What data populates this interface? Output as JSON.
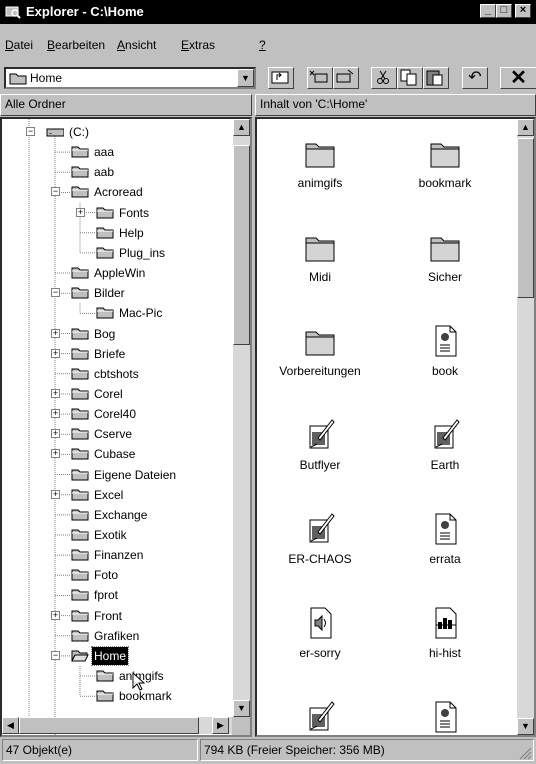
{
  "window": {
    "title": "Explorer - C:\\Home",
    "buttons": {
      "minimize": "_",
      "maximize": "□",
      "close": "×"
    }
  },
  "menu": [
    {
      "label": "Datei",
      "key": "D"
    },
    {
      "label": "Bearbeiten",
      "key": "B"
    },
    {
      "label": "Ansicht",
      "key": "A"
    },
    {
      "label": "Extras",
      "key": "E"
    },
    {
      "label": "?",
      "key": "?"
    }
  ],
  "address": {
    "value": "Home"
  },
  "toolbar": {
    "undo": "↶",
    "delete": "✕"
  },
  "left_header": "Alle Ordner",
  "right_header": "Inhalt von 'C:\\Home'",
  "tree": [
    {
      "label": "(C:)",
      "expander": "-",
      "kind": "drive"
    },
    {
      "label": "aaa",
      "expander": ""
    },
    {
      "label": "aab",
      "expander": ""
    },
    {
      "label": "Acroread",
      "expander": "-"
    },
    {
      "label": "Fonts",
      "expander": "+"
    },
    {
      "label": "Help",
      "expander": ""
    },
    {
      "label": "Plug_ins",
      "expander": ""
    },
    {
      "label": "AppleWin",
      "expander": ""
    },
    {
      "label": "Bilder",
      "expander": "-"
    },
    {
      "label": "Mac-Pic",
      "expander": ""
    },
    {
      "label": "Bog",
      "expander": "+"
    },
    {
      "label": "Briefe",
      "expander": "+"
    },
    {
      "label": "cbtshots",
      "expander": ""
    },
    {
      "label": "Corel",
      "expander": "+"
    },
    {
      "label": "Corel40",
      "expander": "+"
    },
    {
      "label": "Cserve",
      "expander": "+"
    },
    {
      "label": "Cubase",
      "expander": "+"
    },
    {
      "label": "Eigene Dateien",
      "expander": ""
    },
    {
      "label": "Excel",
      "expander": "+"
    },
    {
      "label": "Exchange",
      "expander": ""
    },
    {
      "label": "Exotik",
      "expander": ""
    },
    {
      "label": "Finanzen",
      "expander": ""
    },
    {
      "label": "Foto",
      "expander": ""
    },
    {
      "label": "fprot",
      "expander": ""
    },
    {
      "label": "Front",
      "expander": "+"
    },
    {
      "label": "Grafiken",
      "expander": ""
    },
    {
      "label": "Home",
      "expander": "-",
      "selected": true
    },
    {
      "label": "animgifs",
      "expander": ""
    },
    {
      "label": "bookmark",
      "expander": ""
    }
  ],
  "items": [
    {
      "name": "animgifs",
      "icon": "folder-icon"
    },
    {
      "name": "bookmark",
      "icon": "folder-icon"
    },
    {
      "name": "Midi",
      "icon": "folder-icon"
    },
    {
      "name": "Sicher",
      "icon": "folder-icon"
    },
    {
      "name": "Vorbereitungen",
      "icon": "folder-icon"
    },
    {
      "name": "book",
      "icon": "document-icon"
    },
    {
      "name": "Butflyer",
      "icon": "graphic-icon"
    },
    {
      "name": "Earth",
      "icon": "graphic-icon"
    },
    {
      "name": "ER-CHAOS",
      "icon": "graphic-icon"
    },
    {
      "name": "errata",
      "icon": "document-icon"
    },
    {
      "name": "er-sorry",
      "icon": "sound-icon"
    },
    {
      "name": "hi-hist",
      "icon": "chart-icon"
    }
  ],
  "status": {
    "count": "47 Objekt(e)",
    "size": "794 KB (Freier Speicher: 356 MB)"
  }
}
